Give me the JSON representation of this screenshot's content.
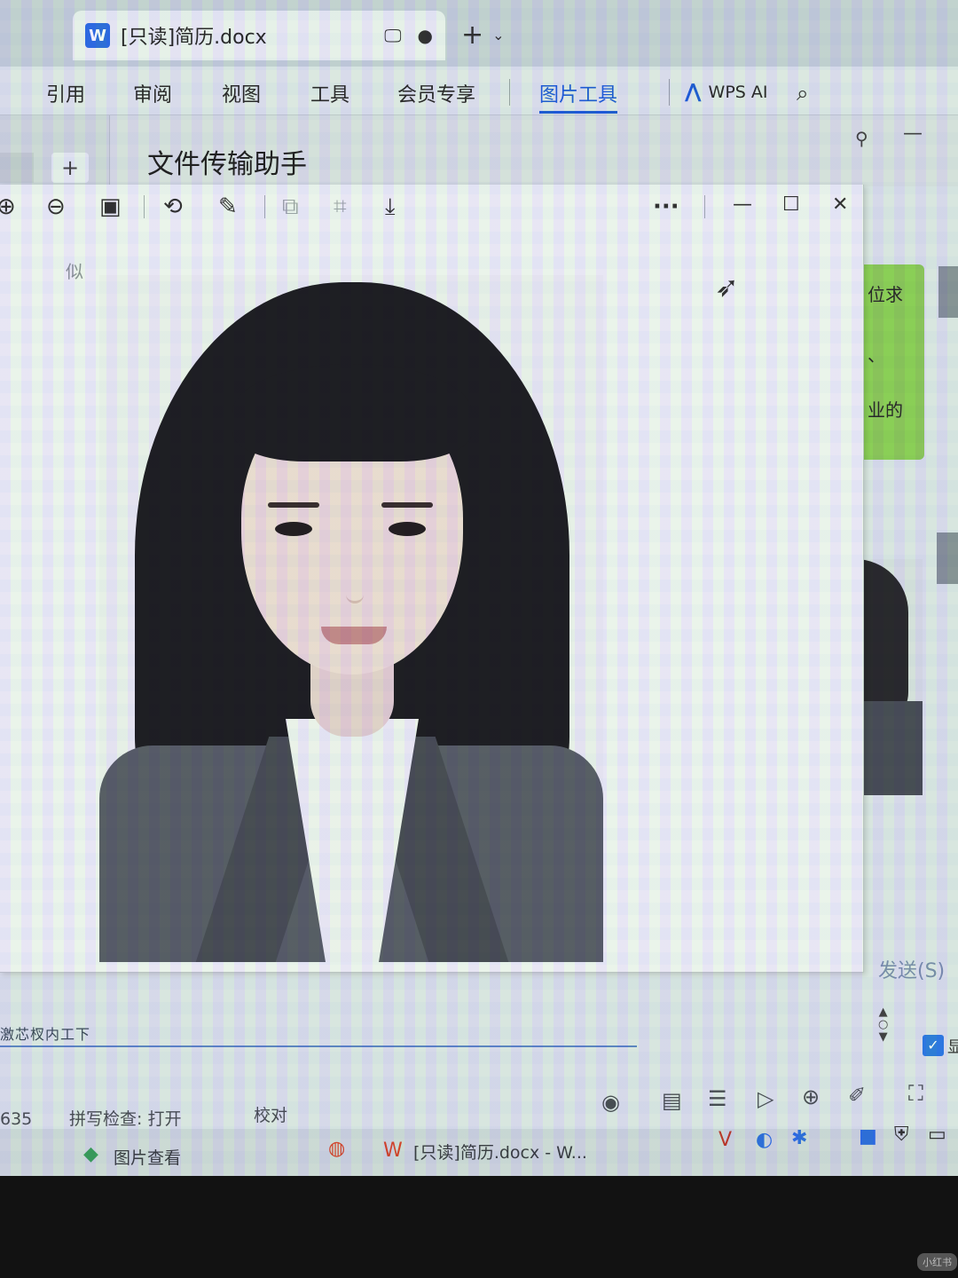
{
  "window": {
    "tab_title": "[只读]简历.docx",
    "tab_add": "+",
    "tab_chevron": "⌄"
  },
  "ribbon": {
    "items": [
      "引用",
      "审阅",
      "视图",
      "工具",
      "会员专享",
      "图片工具"
    ],
    "active": "图片工具",
    "wps_ai": "WPS AI"
  },
  "chat": {
    "title": "文件传输助手",
    "bubble_lines": [
      "位求",
      "、",
      "业的"
    ],
    "send_label": "发送(S)",
    "input_text": "激芯杈内工下",
    "checkbox_label": "显"
  },
  "viewer": {
    "faint_text": "似",
    "toolbar": {
      "more": "···",
      "minimize": "—",
      "maximize": "☐",
      "close": "✕"
    }
  },
  "statusbar": {
    "page_count": "635",
    "spellcheck": "拼写检查: 打开",
    "proofread": "校对"
  },
  "taskbar": {
    "image_viewer": "图片查看",
    "wps_doc": "[只读]简历.docx - W..."
  },
  "icons": {
    "zoom_in": "zoom-in-icon",
    "zoom_out": "zoom-out-icon",
    "fit": "fit-screen-icon",
    "rotate": "rotate-icon",
    "edit": "edit-icon",
    "crop": "crop-icon",
    "ocr": "ocr-icon",
    "download": "download-icon"
  },
  "colors": {
    "accent": "#1f5ed6",
    "bubble": "#8fcf5a",
    "wps_blue": "#2f6fe0"
  },
  "watermark": "小红书"
}
